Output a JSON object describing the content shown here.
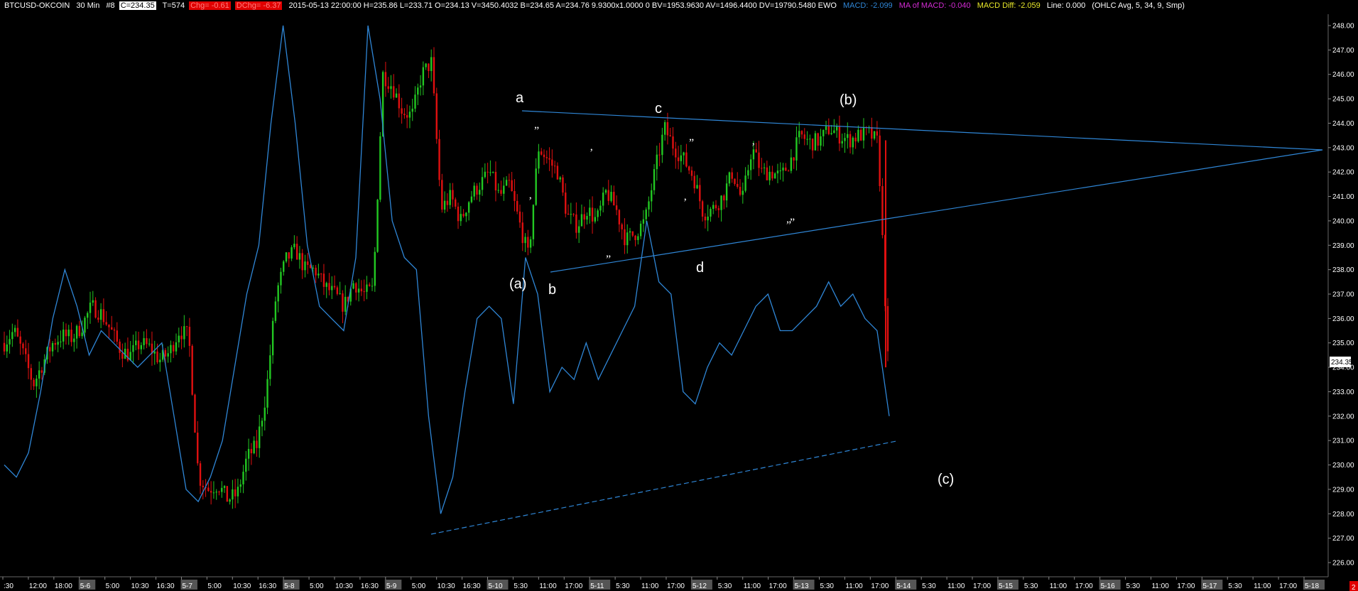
{
  "header": {
    "symbol": "BTCUSD-OKCOIN",
    "interval": "30 Min",
    "num": "#8",
    "close": "C=234.35",
    "ticks": "T=574",
    "chg": "Chg= -0.61",
    "dchg": "DChg= -6.37",
    "bar_info": "2015-05-13 22:00:00 H=235.86 L=233.71 O=234.13 V=3450.4032 B=234.65 A=234.76 9.9300x1.0000 0 BV=1953.9630 AV=1496.4400 DV=19790.5480 EWO",
    "macd": "MACD: -2.099",
    "ma_macd": "MA of MACD: -0.040",
    "macd_diff": "MACD Diff: -2.059",
    "line": "Line: 0.000",
    "params": "(OHLC Avg, 5, 34, 9, Smp)"
  },
  "colors": {
    "up": "#22c822",
    "down": "#e01010",
    "macd": "#2f86d6",
    "trend": "#2f86d6",
    "price_axis_label_bg": "#ffffff",
    "badge_bg": "#e00000"
  },
  "price_tag": "234.35",
  "corner_badge": "2",
  "chart_data": {
    "type": "candlestick",
    "yaxis": {
      "min": 225.5,
      "max": 248.5,
      "ticks": [
        "226.00",
        "227.00",
        "228.00",
        "229.00",
        "230.00",
        "231.00",
        "232.00",
        "233.00",
        "234.00",
        "235.00",
        "236.00",
        "237.00",
        "238.00",
        "239.00",
        "240.00",
        "241.00",
        "242.00",
        "243.00",
        "244.00",
        "245.00",
        "246.00",
        "247.00",
        "248.00"
      ]
    },
    "xaxis": {
      "labels": [
        ":30",
        "12:00",
        "18:00",
        "5-6",
        "5:00",
        "10:30",
        "16:30",
        "5-7",
        "5:00",
        "10:30",
        "16:30",
        "5-8",
        "5:00",
        "10:30",
        "16:30",
        "5-9",
        "5:00",
        "10:30",
        "16:30",
        "5-10",
        "5:30",
        "11:00",
        "17:00",
        "5-11",
        "5:30",
        "11:00",
        "17:00",
        "5-12",
        "5:30",
        "11:00",
        "17:00",
        "5-13",
        "5:30",
        "11:00",
        "17:00",
        "5-14",
        "5:30",
        "11:00",
        "17:00",
        "5-15",
        "5:30",
        "11:00",
        "17:00",
        "5-16",
        "5:30",
        "11:00",
        "17:00",
        "5-17",
        "5:30",
        "11:00",
        "17:00",
        "5-18"
      ],
      "date_labels": [
        "5-6",
        "5-7",
        "5-8",
        "5-9",
        "5-10",
        "5-11",
        "5-12",
        "5-13",
        "5-14",
        "5-15",
        "5-16",
        "5-17",
        "5-18"
      ]
    },
    "last_close": 234.35,
    "price_path": [
      235.0,
      235.5,
      234.5,
      233.3,
      234.2,
      235.0,
      235.3,
      235.2,
      235.7,
      236.5,
      236.2,
      235.5,
      234.7,
      234.5,
      235.0,
      234.8,
      234.3,
      234.6,
      235.5,
      235.3,
      229.5,
      229.0,
      229.2,
      228.6,
      228.8,
      230.3,
      230.8,
      233.0,
      237.0,
      238.4,
      238.8,
      238.0,
      238.0,
      237.3,
      237.0,
      236.5,
      237.5,
      237.0,
      237.2,
      246.0,
      245.5,
      244.5,
      244.3,
      246.0,
      246.5,
      240.5,
      241.0,
      240.0,
      241.0,
      241.5,
      242.0,
      241.0,
      241.5,
      240.0,
      238.5,
      243.0,
      242.5,
      242.0,
      240.2,
      239.8,
      240.5,
      240.0,
      241.2,
      240.5,
      239.2,
      239.5,
      240.0,
      242.0,
      243.8,
      243.0,
      242.5,
      241.8,
      240.3,
      240.5,
      241.0,
      242.0,
      240.8,
      243.0,
      242.0,
      242.0,
      241.8,
      242.5,
      243.5,
      243.2,
      243.3,
      243.8,
      243.5,
      243.3,
      243.5,
      243.6,
      243.2,
      234.35
    ],
    "macd_path": [
      230.0,
      229.5,
      230.5,
      233.0,
      236.0,
      238.0,
      236.5,
      234.5,
      235.5,
      235.0,
      234.5,
      234.0,
      234.5,
      235.0,
      232.0,
      229.0,
      228.5,
      229.5,
      231.0,
      234.0,
      237.0,
      239.0,
      244.0,
      248.0,
      244.0,
      239.0,
      236.5,
      236.0,
      235.5,
      238.5,
      248.0,
      245.0,
      240.0,
      238.5,
      238.0,
      232.0,
      228.0,
      229.5,
      233.0,
      236.0,
      236.5,
      236.0,
      232.5,
      238.5,
      237.0,
      233.0,
      234.0,
      233.5,
      235.0,
      233.5,
      234.5,
      235.5,
      236.5,
      240.0,
      237.5,
      237.0,
      233.0,
      232.5,
      234.0,
      235.0,
      234.5,
      235.5,
      236.5,
      237.0,
      235.5,
      235.5,
      236.0,
      236.5,
      237.5,
      236.5,
      237.0,
      236.0,
      235.5,
      232.0
    ],
    "annotations": {
      "waves": [
        "a",
        "b",
        "c",
        "d",
        "(a)",
        "(b)",
        "(c)"
      ],
      "minor_marks": [
        "”",
        "”",
        "”",
        "”",
        "”",
        "’",
        "’",
        "’",
        "’"
      ]
    },
    "trendlines": [
      {
        "style": "solid",
        "from": [
          "5-10 10:00",
          244.8
        ],
        "to": [
          "5-18 09:00",
          243.1
        ]
      },
      {
        "style": "solid",
        "from": [
          "5-10 20:00",
          238.0
        ],
        "to": [
          "5-18 09:00",
          243.1
        ]
      },
      {
        "style": "dashed",
        "from": [
          "5-9 10:30",
          227.3
        ],
        "to": [
          "5-14 06:00",
          231.1
        ]
      }
    ],
    "grid": false,
    "legend": "none"
  }
}
